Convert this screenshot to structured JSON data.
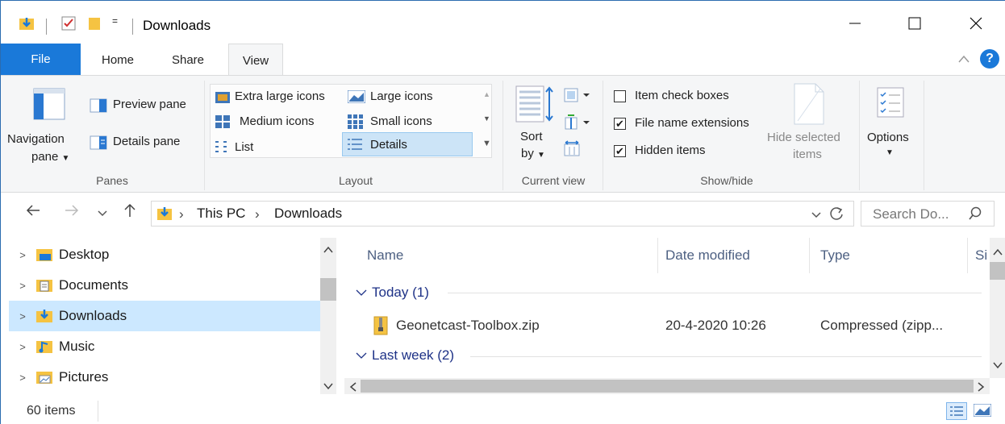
{
  "window": {
    "title": "Downloads",
    "minimize_icon": "minimize-icon",
    "maximize_icon": "maximize-icon",
    "close_icon": "close-icon"
  },
  "quick_access": {
    "dropdown_glyph": "="
  },
  "tabs": [
    {
      "label": "File"
    },
    {
      "label": "Home"
    },
    {
      "label": "Share"
    },
    {
      "label": "View"
    }
  ],
  "ribbon": {
    "panes": {
      "navigation_pane": "Navigation",
      "navigation_pane_2": "pane",
      "preview_pane": "Preview pane",
      "details_pane": "Details pane",
      "group": "Panes"
    },
    "layout": {
      "items": [
        "Extra large icons",
        "Large icons",
        "Medium icons",
        "Small icons",
        "List",
        "Details"
      ],
      "selected": "Details",
      "group": "Layout"
    },
    "current_view": {
      "sort_by": "Sort",
      "sort_by_2": "by",
      "group": "Current view"
    },
    "show_hide": {
      "item_check_boxes": "Item check boxes",
      "file_name_extensions": "File name extensions",
      "hidden_items": "Hidden items",
      "hide_selected": "Hide selected",
      "hide_selected_2": "items",
      "group": "Show/hide",
      "checked": {
        "item_check_boxes": false,
        "file_name_extensions": true,
        "hidden_items": true
      }
    },
    "options": {
      "label": "Options"
    }
  },
  "address": {
    "breadcrumb": [
      "This PC",
      "Downloads"
    ],
    "search_placeholder": "Search Do..."
  },
  "nav_pane": {
    "items": [
      {
        "label": "Desktop",
        "selected": false
      },
      {
        "label": "Documents",
        "selected": false
      },
      {
        "label": "Downloads",
        "selected": true
      },
      {
        "label": "Music",
        "selected": false
      },
      {
        "label": "Pictures",
        "selected": false
      }
    ]
  },
  "file_list": {
    "columns": [
      "Name",
      "Date modified",
      "Type",
      "Si"
    ],
    "groups": [
      {
        "label": "Today (1)"
      },
      {
        "label": "Last week (2)"
      }
    ],
    "rows": [
      {
        "name": "Geonetcast-Toolbox.zip",
        "date": "20-4-2020 10:26",
        "type": "Compressed (zipp..."
      }
    ]
  },
  "status": {
    "item_count": "60 items"
  },
  "colors": {
    "accent": "#1a79d9",
    "selection": "#cce8ff",
    "folder": "#f5c342",
    "group_text": "#1e3287"
  }
}
